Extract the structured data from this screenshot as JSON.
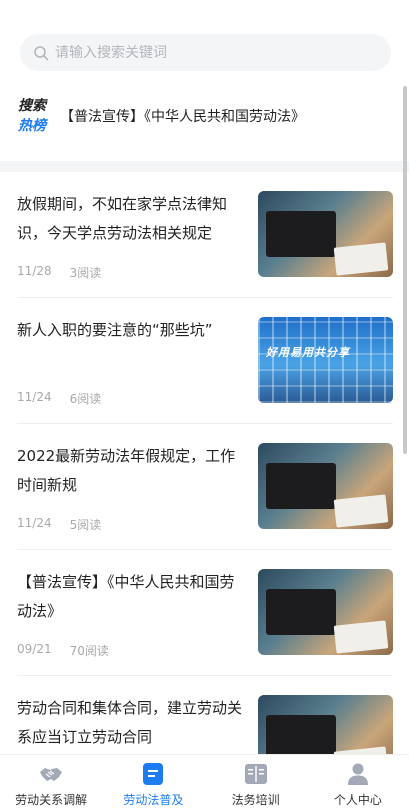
{
  "search": {
    "placeholder": "请输入搜索关键词"
  },
  "hot": {
    "badge_line1": "搜索",
    "badge_line2": "热榜",
    "text": "【普法宣传】《中华人民共和国劳动法》"
  },
  "articles": [
    {
      "title": "放假期间，不如在家学点法律知识，今天学点劳动法相关规定",
      "date": "11/28",
      "reads": "3阅读",
      "image": "office-photo"
    },
    {
      "title": "新人入职的要注意的“那些坑”",
      "date": "11/24",
      "reads": "6阅读",
      "image": "construction-site-photo",
      "image_caption": "好用易用共分享"
    },
    {
      "title": "2022最新劳动法年假规定，工作时间新规",
      "date": "11/24",
      "reads": "5阅读",
      "image": "office-photo"
    },
    {
      "title": "【普法宣传】《中华人民共和国劳动法》",
      "date": "09/21",
      "reads": "70阅读",
      "image": "office-photo"
    },
    {
      "title": "劳动合同和集体合同，建立劳动关系应当订立劳动合同",
      "date": "",
      "reads": "",
      "image": "office-photo"
    }
  ],
  "tabs": [
    {
      "label": "劳动关系调解",
      "icon": "handshake-icon",
      "active": false
    },
    {
      "label": "劳动法普及",
      "icon": "document-icon",
      "active": true
    },
    {
      "label": "法务培训",
      "icon": "book-icon",
      "active": false
    },
    {
      "label": "个人中心",
      "icon": "user-icon",
      "active": false
    }
  ],
  "colors": {
    "accent": "#1e7cf2",
    "meta_text": "#a9a9a9",
    "background_band": "#f4f5f7"
  }
}
